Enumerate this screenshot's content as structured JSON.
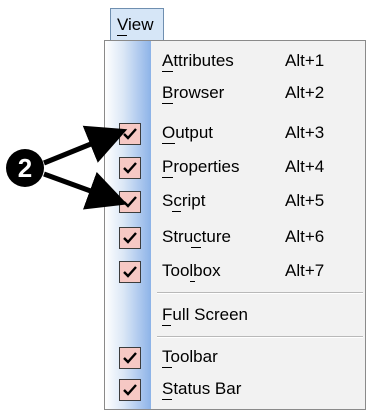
{
  "menubar": {
    "view_label": "View"
  },
  "menu": {
    "items": [
      {
        "label": "Attributes",
        "shortcut": "Alt+1",
        "checked": false
      },
      {
        "label": "Browser",
        "shortcut": "Alt+2",
        "checked": false
      },
      {
        "label": "Output",
        "shortcut": "Alt+3",
        "checked": true
      },
      {
        "label": "Properties",
        "shortcut": "Alt+4",
        "checked": true
      },
      {
        "label": "Script",
        "shortcut": "Alt+5",
        "checked": true
      },
      {
        "label": "Structure",
        "shortcut": "Alt+6",
        "checked": true
      },
      {
        "label": "Toolbox",
        "shortcut": "Alt+7",
        "checked": true
      },
      {
        "label": "Full Screen",
        "shortcut": "",
        "checked": false
      },
      {
        "label": "Toolbar",
        "shortcut": "",
        "checked": true
      },
      {
        "label": "Status Bar",
        "shortcut": "",
        "checked": true
      }
    ]
  },
  "callout": {
    "number": "2"
  },
  "colors": {
    "check_bg": "#f6c8c4",
    "gutter_blue": "#8db3e8",
    "menubar_bg": "#d6e6f7"
  }
}
